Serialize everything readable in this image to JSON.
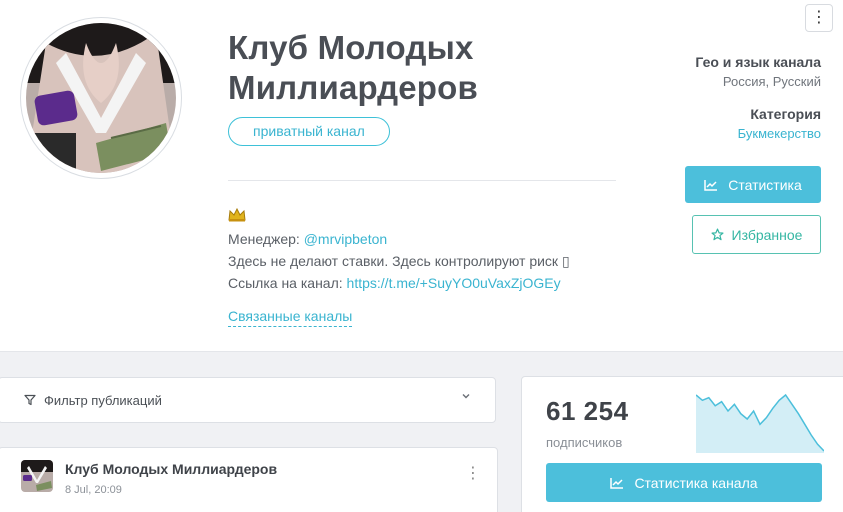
{
  "header": {
    "channel_title": "Клуб Молодых Миллиардеров",
    "tag": "приватный канал",
    "description": {
      "crown_icon": "crown-emoji",
      "manager_label": "Менеджер: ",
      "manager_handle": "@mrvipbeton",
      "line2": "Здесь не делают ставки. Здесь контролируют риск ▯",
      "link_label": "Ссылка на канал: ",
      "link_url": "https://t.me/+SuyYO0uVaxZjOGEy"
    },
    "related_link": "Связанные каналы",
    "geo_label": "Гео и язык канала",
    "geo_value": "Россия, Русский",
    "category_label": "Категория",
    "category_value": "Букмекерство",
    "stats_button": "Статистика",
    "favorite_button": "Избранное"
  },
  "filter": {
    "label": "Фильтр публикаций",
    "icon": "filter-icon"
  },
  "post": {
    "title": "Клуб Молодых Миллиардеров",
    "date": "8 Jul, 20:09",
    "menu_icon": "more-vertical-icon"
  },
  "stats_card": {
    "subscribers": "61 254",
    "subscribers_label": "подписчиков",
    "channel_stats_button": "Статистика канала",
    "sparkline": [
      62,
      58,
      60,
      54,
      57,
      50,
      55,
      48,
      44,
      50,
      40,
      45,
      52,
      58,
      62,
      55,
      48,
      40,
      32,
      25,
      20
    ]
  },
  "colors": {
    "accent": "#4cbfdb",
    "favorite": "#35b6a3",
    "link": "#3ab4d0"
  }
}
